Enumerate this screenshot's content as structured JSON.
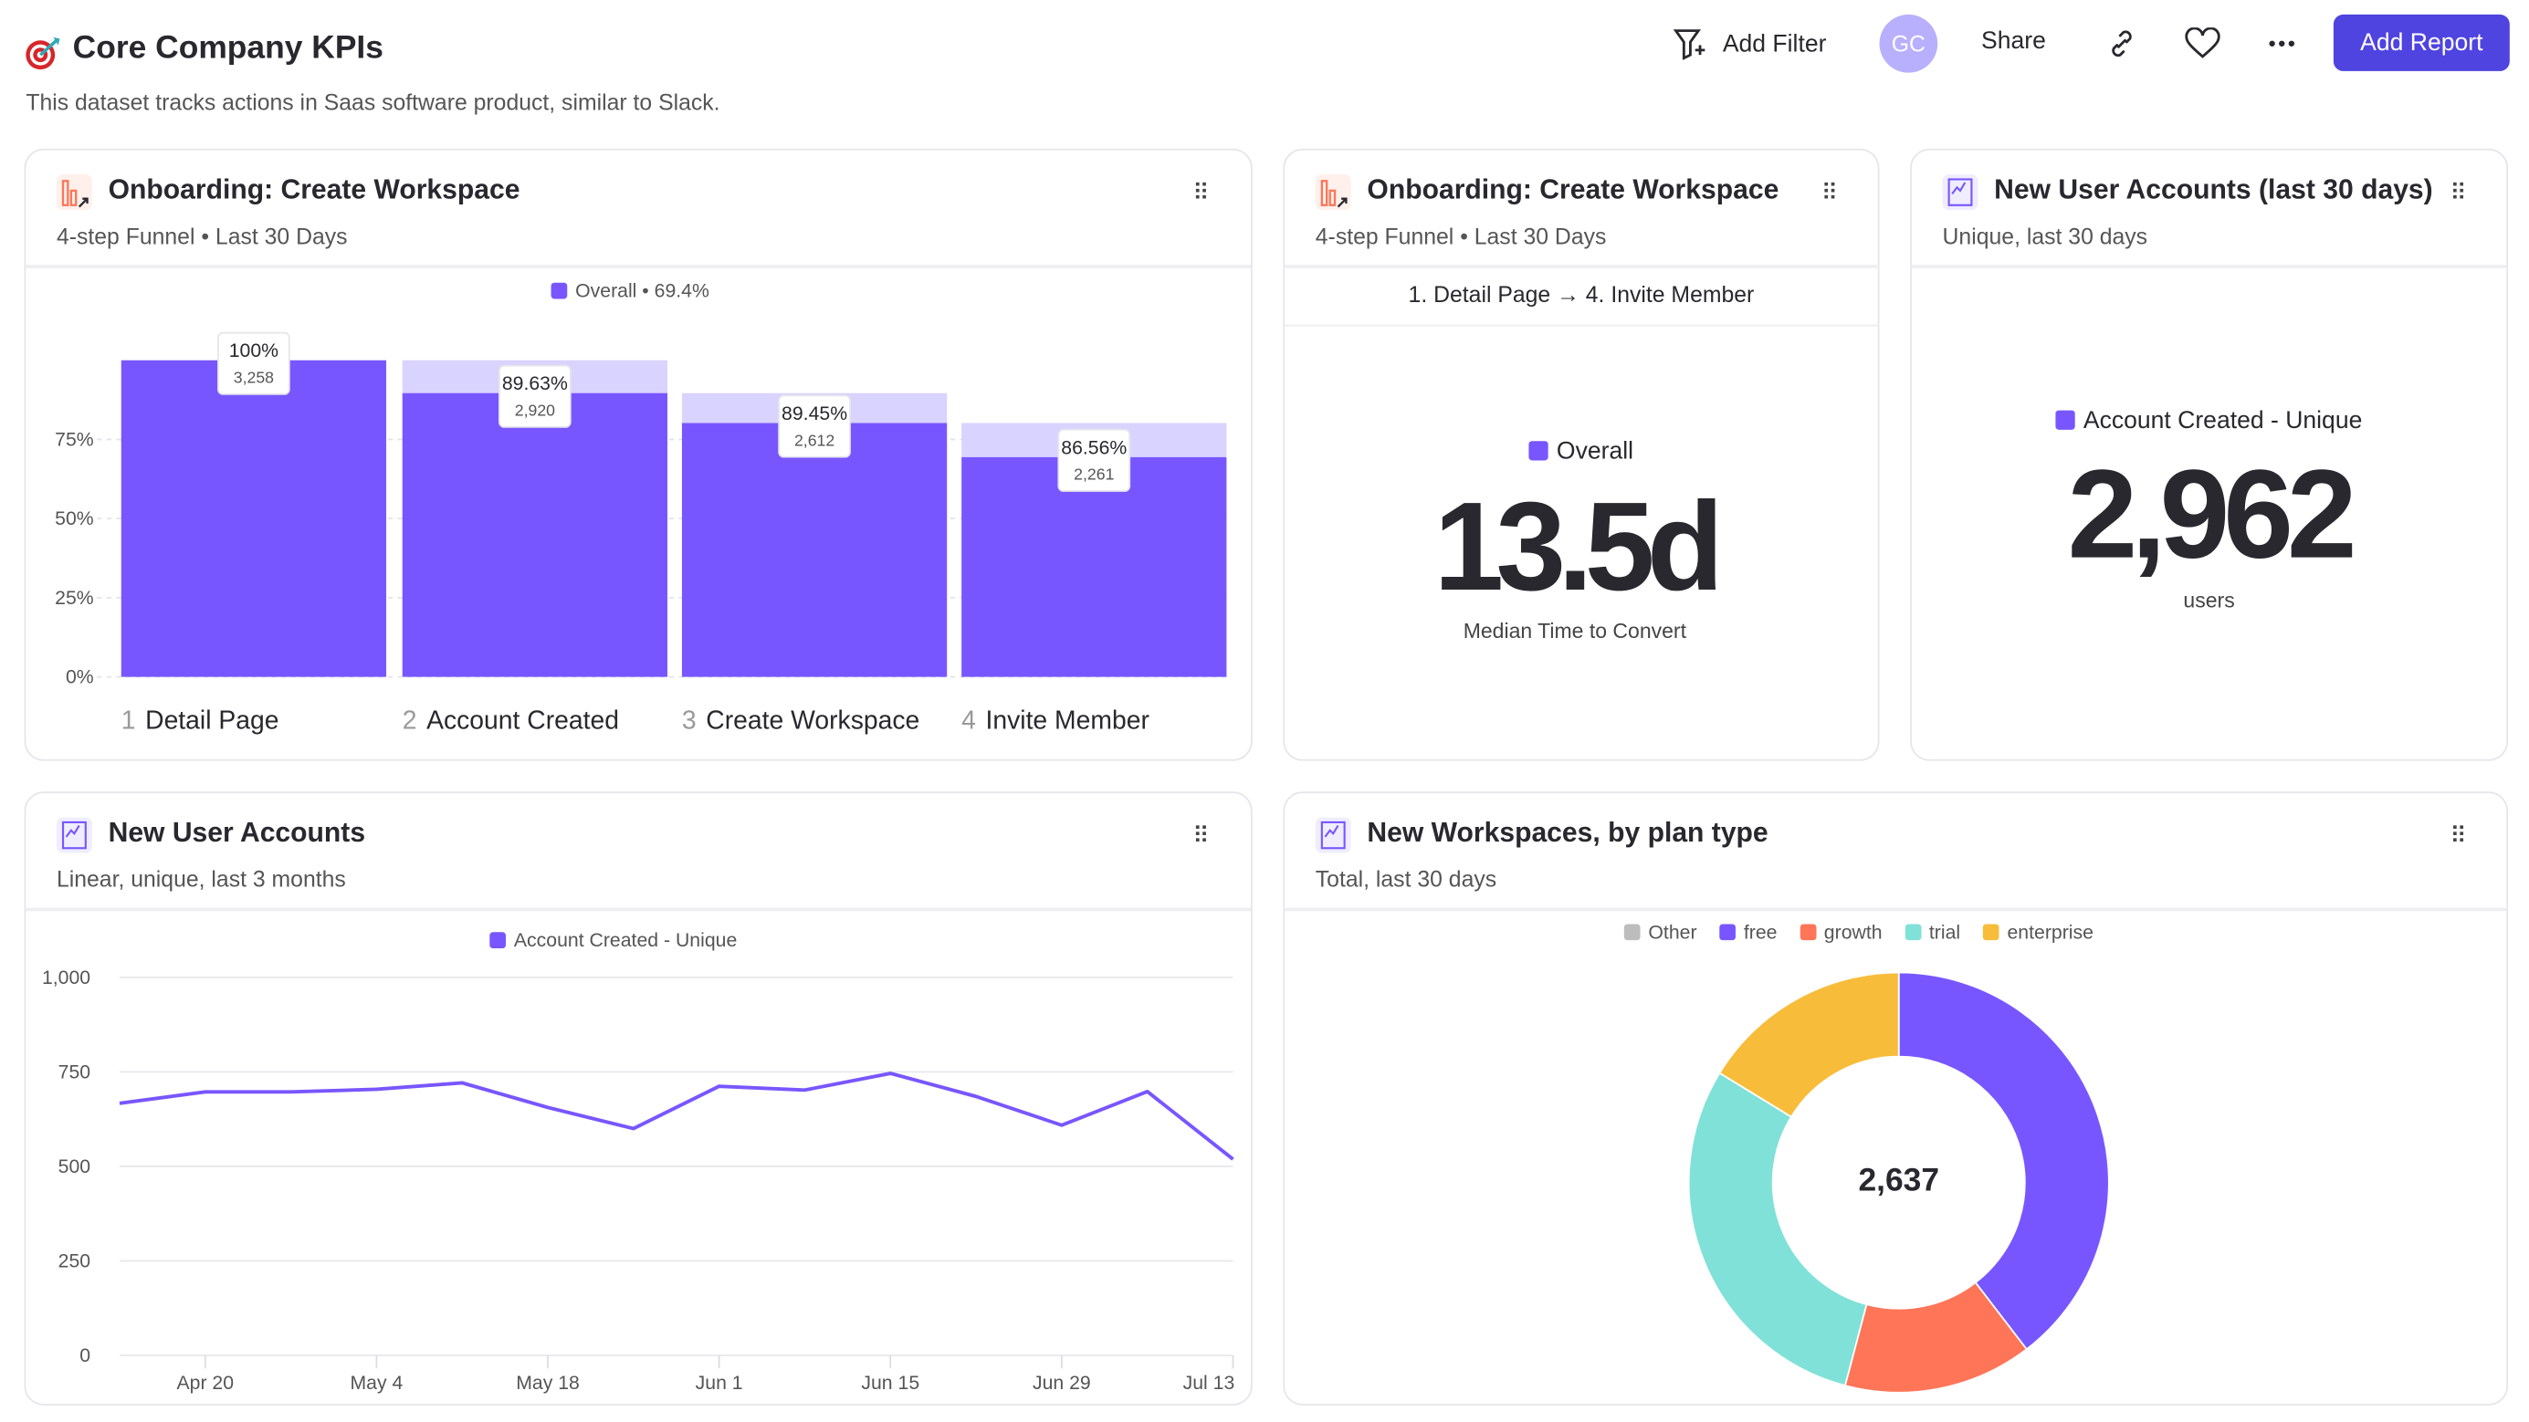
{
  "header": {
    "title": "Core Company KPIs",
    "description": "This dataset tracks actions in Saas software product, similar to Slack.",
    "add_filter": "Add Filter",
    "avatar": "GC",
    "share": "Share",
    "add_report": "Add Report",
    "icons": [
      "target-icon",
      "filter-plus-icon",
      "link-icon",
      "heart-icon",
      "more-icon"
    ]
  },
  "colors": {
    "accent": "#7856ff",
    "primary_button": "#4f44e0",
    "avatar": "#b8b0fc",
    "growth": "#ff7557",
    "trial": "#80e1d9",
    "enterprise": "#f8bc3b",
    "other": "#bdbdbd"
  },
  "cards": {
    "funnel": {
      "title": "Onboarding: Create Workspace",
      "subtitle": "4-step Funnel • Last 30 Days",
      "legend": "Overall • 69.4%"
    },
    "time": {
      "title": "Onboarding: Create Workspace",
      "subtitle": "4-step Funnel • Last 30 Days",
      "range": "1. Detail Page → 4. Invite Member",
      "legend": "Overall",
      "value": "13.5d",
      "caption": "Median Time to Convert"
    },
    "users30": {
      "title": "New User Accounts (last 30 days)",
      "subtitle": "Unique, last 30 days",
      "legend": "Account Created - Unique",
      "value": "2,962",
      "caption": "users"
    },
    "users": {
      "title": "New User Accounts",
      "subtitle": "Linear, unique, last 3 months",
      "legend": "Account Created - Unique"
    },
    "workspaces": {
      "title": "New Workspaces, by plan type",
      "subtitle": "Total, last 30 days",
      "center": "2,637"
    }
  },
  "chart_data": [
    {
      "type": "bar",
      "subtype": "funnel",
      "yticks": [
        "0%",
        "25%",
        "50%",
        "75%"
      ],
      "ylim": [
        0,
        100
      ],
      "steps": [
        {
          "num": "1",
          "name": "Detail Page",
          "pct": "100%",
          "count": "3,258",
          "value": 3258
        },
        {
          "num": "2",
          "name": "Account Created",
          "pct": "89.63%",
          "count": "2,920",
          "value": 2920
        },
        {
          "num": "3",
          "name": "Create Workspace",
          "pct": "89.45%",
          "count": "2,612",
          "value": 2612
        },
        {
          "num": "4",
          "name": "Invite Member",
          "pct": "86.56%",
          "count": "2,261",
          "value": 2261
        }
      ]
    },
    {
      "type": "line",
      "ylim": [
        0,
        1000
      ],
      "yticks": [
        "0",
        "250",
        "500",
        "750",
        "1,000"
      ],
      "xticks": [
        "Apr 20",
        "May 4",
        "May 18",
        "Jun 1",
        "Jun 15",
        "Jun 29",
        "Jul 13"
      ],
      "x": [
        "Apr 13",
        "Apr 20",
        "Apr 27",
        "May 4",
        "May 11",
        "May 18",
        "May 25",
        "Jun 1",
        "Jun 8",
        "Jun 15",
        "Jun 22",
        "Jun 29",
        "Jul 6",
        "Jul 13"
      ],
      "series": [
        {
          "name": "Account Created - Unique",
          "values": [
            667,
            697,
            697,
            704,
            721,
            656,
            600,
            712,
            702,
            746,
            685,
            609,
            698,
            519
          ]
        }
      ]
    },
    {
      "type": "pie",
      "subtype": "donut",
      "total": 2637,
      "legend": [
        "Other",
        "free",
        "growth",
        "trial",
        "enterprise"
      ],
      "slices": [
        {
          "label": "free",
          "value": 1044
        },
        {
          "label": "growth",
          "value": 383
        },
        {
          "label": "trial",
          "value": 781
        },
        {
          "label": "enterprise",
          "value": 429
        },
        {
          "label": "Other",
          "value": 0
        }
      ]
    }
  ]
}
